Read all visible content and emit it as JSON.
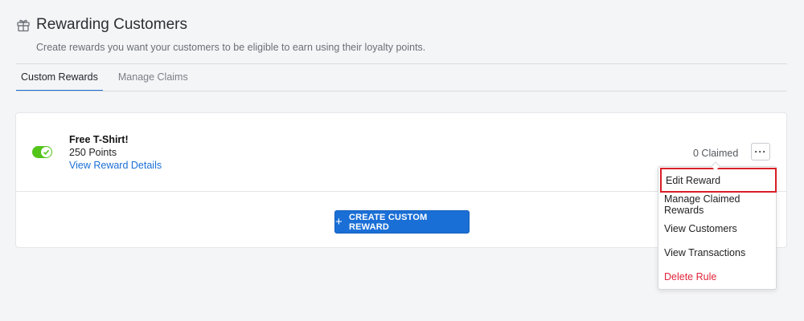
{
  "header": {
    "title": "Rewarding Customers",
    "subtitle": "Create rewards you want your customers to be eligible to earn using their loyalty points.",
    "icon": "gift-icon"
  },
  "tabs": [
    {
      "label": "Custom Rewards",
      "active": true
    },
    {
      "label": "Manage Claims",
      "active": false
    }
  ],
  "reward": {
    "name": "Free T-Shirt!",
    "points": "250 Points",
    "details_link": "View Reward Details",
    "claimed": "0 Claimed",
    "enabled": true,
    "more_label": "···"
  },
  "create_button": {
    "icon": "+",
    "label": "CREATE CUSTOM REWARD"
  },
  "menu": {
    "items": [
      {
        "label": "Edit Reward",
        "highlighted": true
      },
      {
        "label": "Manage Claimed Rewards"
      },
      {
        "label": "View Customers"
      },
      {
        "label": "View Transactions"
      },
      {
        "label": "Delete Rule",
        "danger": true
      }
    ]
  },
  "colors": {
    "accent": "#1a6fd6",
    "toggle_on": "#52c41a",
    "danger": "#e0243a",
    "highlight_border": "#d91f26"
  }
}
